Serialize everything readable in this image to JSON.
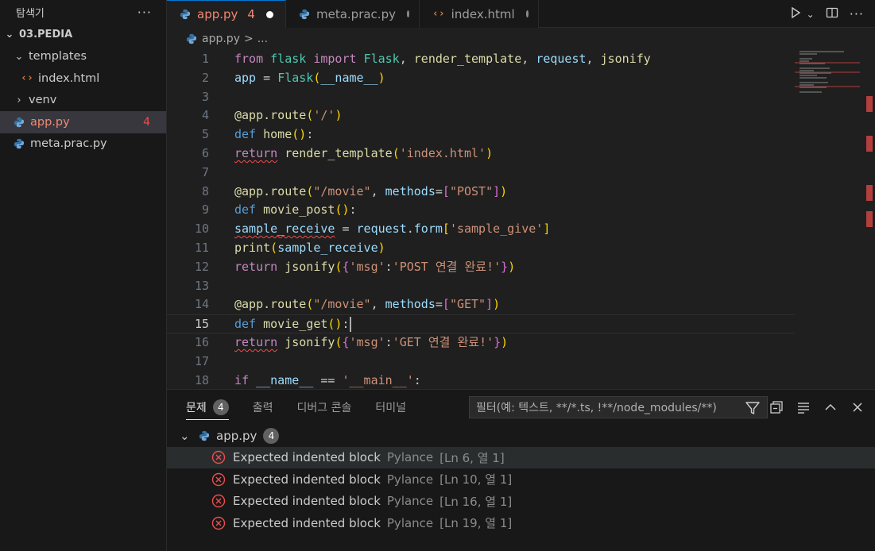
{
  "sidebar": {
    "title": "탐색기",
    "more": "···",
    "root": "03.PEDIA",
    "items": [
      {
        "label": "templates",
        "kind": "folder-open"
      },
      {
        "label": "index.html",
        "kind": "html"
      },
      {
        "label": "venv",
        "kind": "folder-closed"
      },
      {
        "label": "app.py",
        "kind": "python",
        "errors": "4"
      },
      {
        "label": "meta.prac.py",
        "kind": "python"
      }
    ]
  },
  "tabs": [
    {
      "label": "app.py",
      "errors": "4",
      "icon": "python-icon"
    },
    {
      "label": "meta.prac.py",
      "icon": "python-icon"
    },
    {
      "label": "index.html",
      "icon": "html-icon"
    }
  ],
  "breadcrumb": {
    "file": "app.py",
    "sep": ">",
    "rest": "..."
  },
  "editor": {
    "line_numbers": [
      "1",
      "2",
      "3",
      "4",
      "5",
      "6",
      "7",
      "8",
      "9",
      "10",
      "11",
      "12",
      "13",
      "14",
      "15",
      "16",
      "17",
      "18"
    ],
    "current_line": "15"
  },
  "panel": {
    "tabs": [
      {
        "label": "문제",
        "badge": "4"
      },
      {
        "label": "출력"
      },
      {
        "label": "디버그 콘솔"
      },
      {
        "label": "터미널"
      }
    ],
    "filter_placeholder": "필터(예: 텍스트, **/*.ts, !**/node_modules/**)",
    "group": {
      "file": "app.py",
      "count": "4"
    },
    "problems": [
      {
        "message": "Expected indented block",
        "source": "Pylance",
        "location": "[Ln 6, 열 1]"
      },
      {
        "message": "Expected indented block",
        "source": "Pylance",
        "location": "[Ln 10, 열 1]"
      },
      {
        "message": "Expected indented block",
        "source": "Pylance",
        "location": "[Ln 16, 열 1]"
      },
      {
        "message": "Expected indented block",
        "source": "Pylance",
        "location": "[Ln 19, 열 1]"
      }
    ]
  },
  "colors": {
    "error": "#f14c4c",
    "accent": "#0078d4",
    "background": "#1f1f1f"
  }
}
